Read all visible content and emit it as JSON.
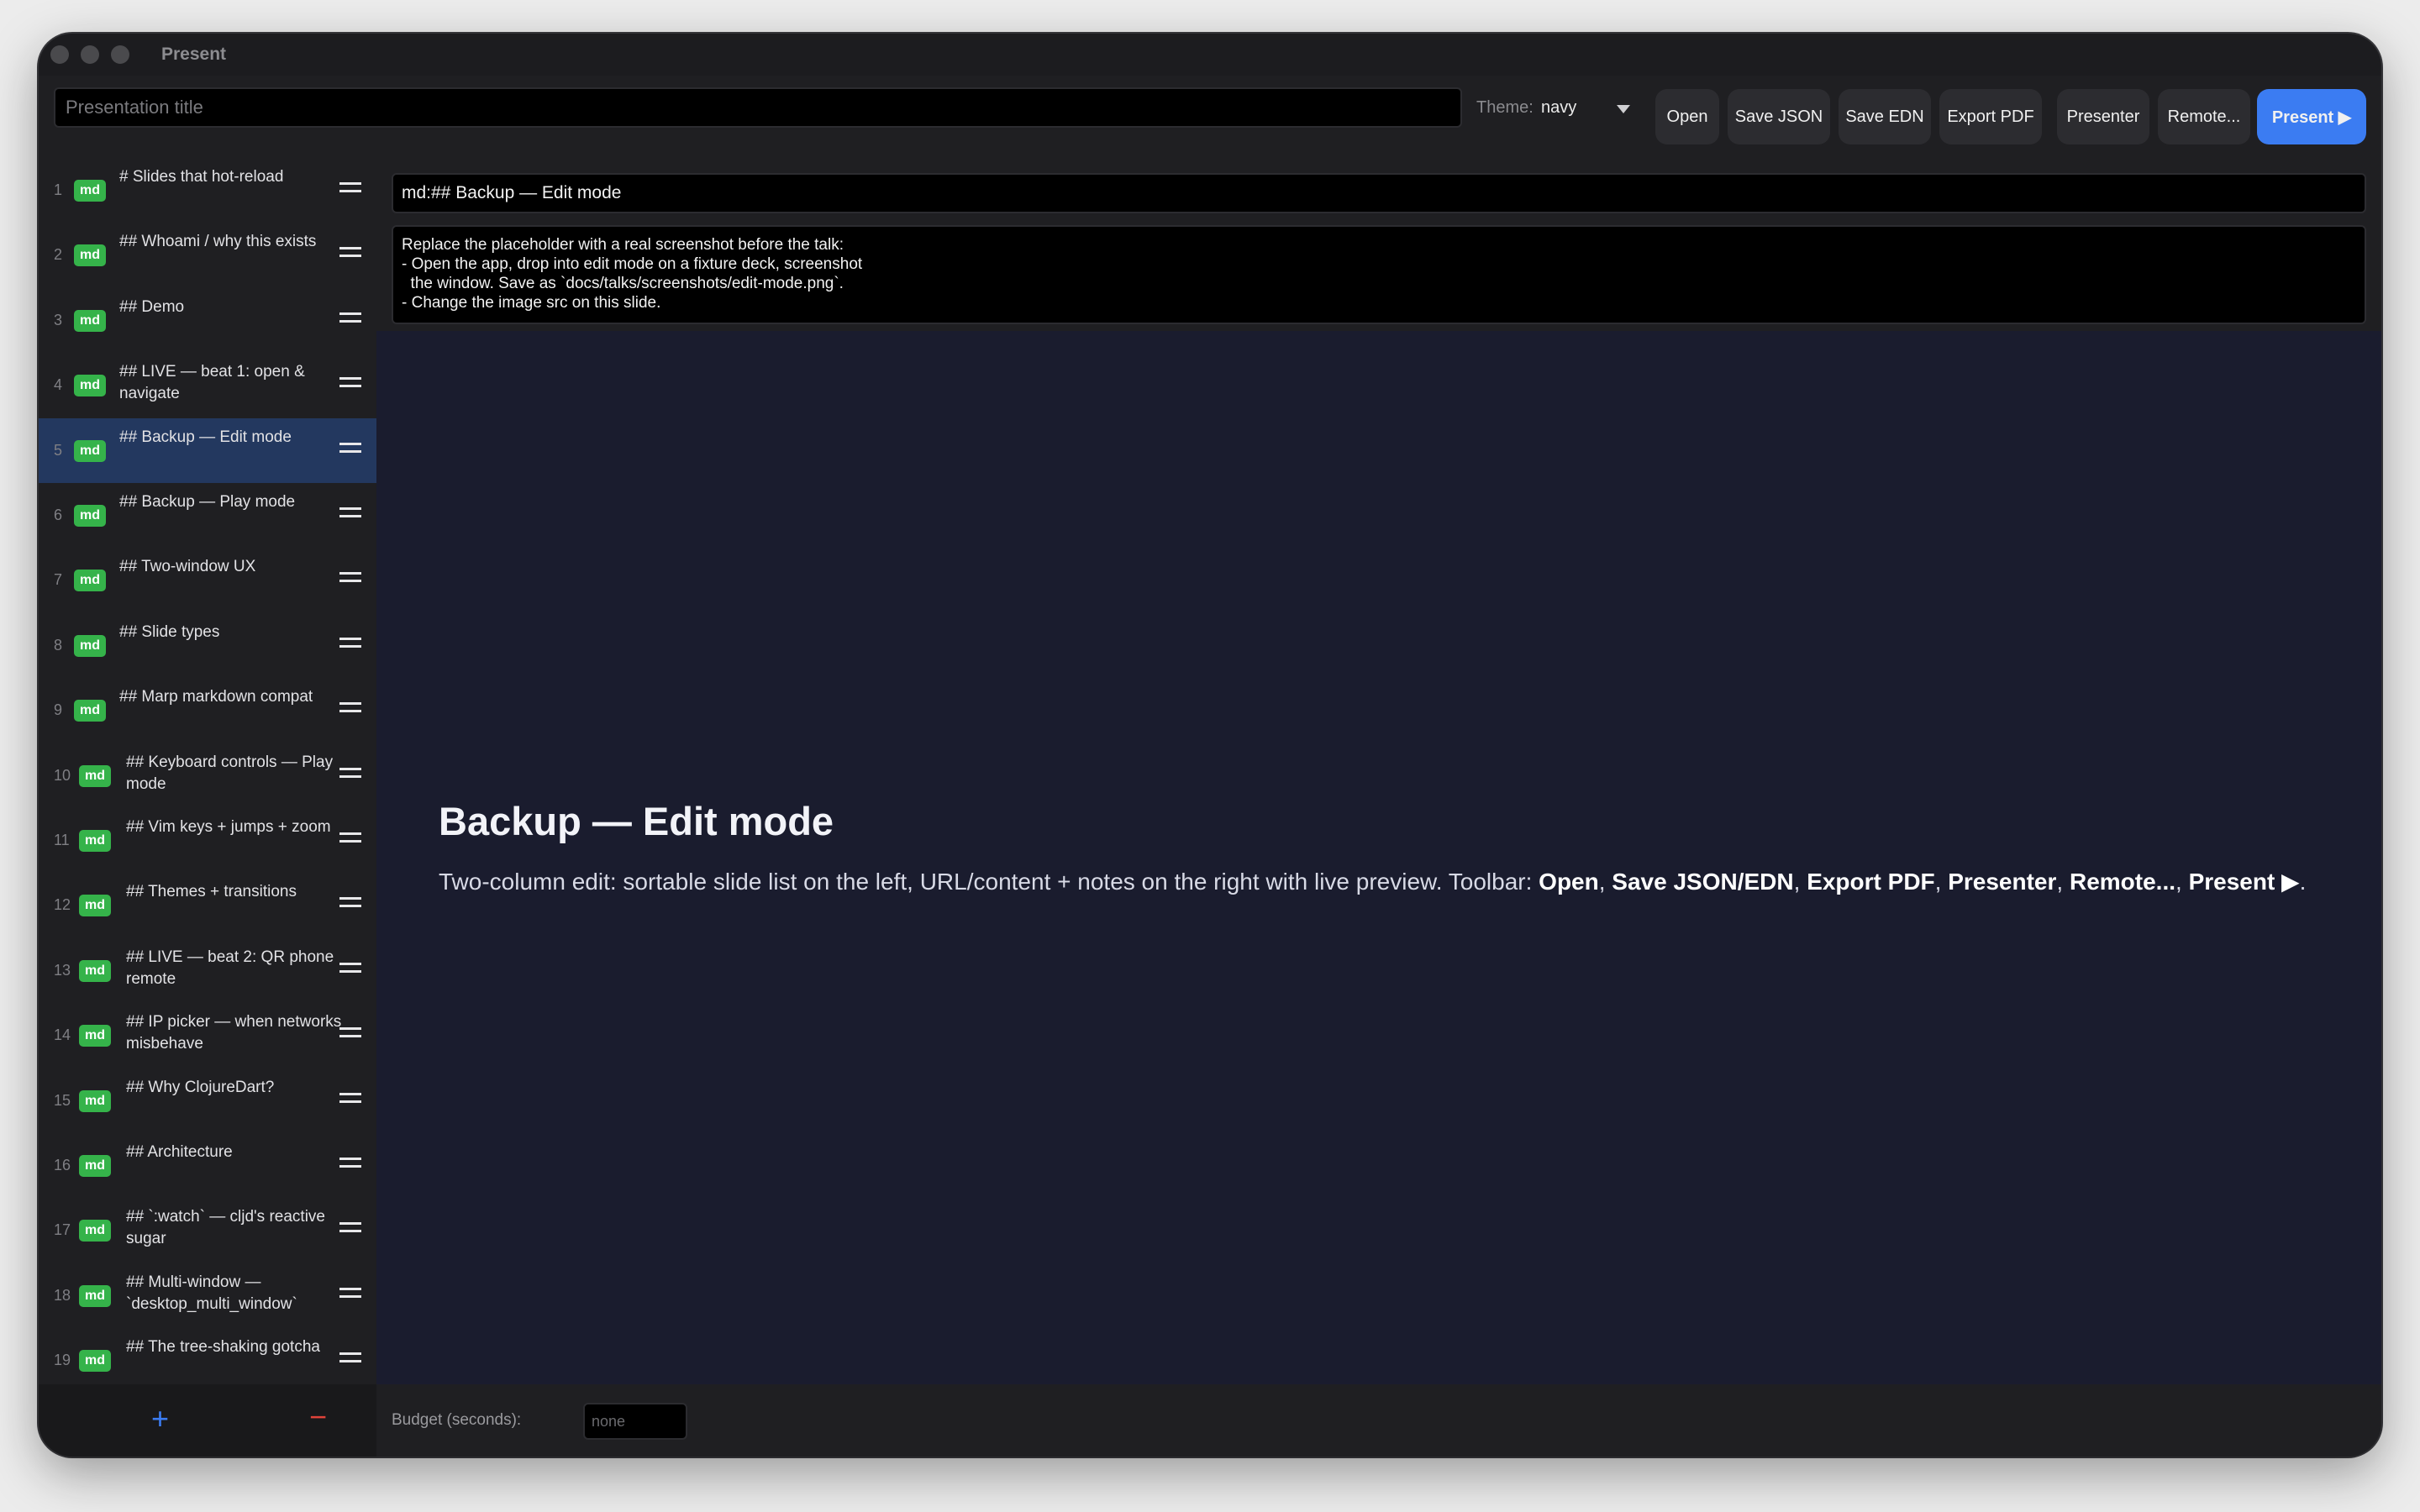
{
  "window": {
    "title": "Present"
  },
  "toolbar": {
    "title_placeholder": "Presentation title",
    "theme_label": "Theme:",
    "theme_value": "navy",
    "buttons": {
      "open": "Open",
      "save_json": "Save JSON",
      "save_edn": "Save EDN",
      "export_pdf": "Export PDF",
      "presenter": "Presenter",
      "remote": "Remote...",
      "present": "Present ▶"
    }
  },
  "sidebar": {
    "badge": "md",
    "selected_index": 5,
    "items": [
      {
        "num": "1",
        "label": "# Slides that hot-reload"
      },
      {
        "num": "2",
        "label": "## Whoami / why this exists"
      },
      {
        "num": "3",
        "label": "## Demo"
      },
      {
        "num": "4",
        "label": "## LIVE — beat 1: open & navigate"
      },
      {
        "num": "5",
        "label": "## Backup — Edit mode"
      },
      {
        "num": "6",
        "label": "## Backup — Play mode"
      },
      {
        "num": "7",
        "label": "## Two-window UX"
      },
      {
        "num": "8",
        "label": "## Slide types"
      },
      {
        "num": "9",
        "label": "## Marp markdown compat"
      },
      {
        "num": "10",
        "label": "## Keyboard controls — Play mode"
      },
      {
        "num": "11",
        "label": "## Vim keys + jumps + zoom"
      },
      {
        "num": "12",
        "label": "## Themes + transitions"
      },
      {
        "num": "13",
        "label": "## LIVE — beat 2: QR phone remote"
      },
      {
        "num": "14",
        "label": "## IP picker — when networks misbehave"
      },
      {
        "num": "15",
        "label": "## Why ClojureDart?"
      },
      {
        "num": "16",
        "label": "## Architecture"
      },
      {
        "num": "17",
        "label": "## `:watch` — cljd's reactive sugar"
      },
      {
        "num": "18",
        "label": "## Multi-window — `desktop_multi_window`"
      },
      {
        "num": "19",
        "label": "## The tree-shaking gotcha"
      }
    ],
    "add_label": "+",
    "remove_label": "−"
  },
  "editor": {
    "url_value": "md:## Backup — Edit mode",
    "notes": "Replace the placeholder with a real screenshot before the talk:\n- Open the app, drop into edit mode on a fixture deck, screenshot\n  the window. Save as `docs/talks/screenshots/edit-mode.png`.\n- Change the image src on this slide."
  },
  "preview": {
    "title": "Backup — Edit mode",
    "body_plain": "Two-column edit: sortable slide list on the left, URL/content + notes on the right with live preview. Toolbar: ",
    "bold_open": "Open",
    "sep1": ", ",
    "bold_save": "Save JSON/EDN",
    "sep2": ", ",
    "bold_export": "Export PDF",
    "sep3": ", ",
    "bold_presenter": "Presenter",
    "sep4": ", ",
    "bold_remote": "Remote...",
    "sep5": ", ",
    "bold_present": "Present ▶",
    "end": "."
  },
  "footer": {
    "budget_label": "Budget (seconds):",
    "budget_placeholder": "none"
  },
  "colors": {
    "accent": "#3b7cf2",
    "badge": "#35b34a",
    "selected": "#23385f",
    "remove": "#e0433a",
    "preview_bg": "#1a1c2e"
  }
}
